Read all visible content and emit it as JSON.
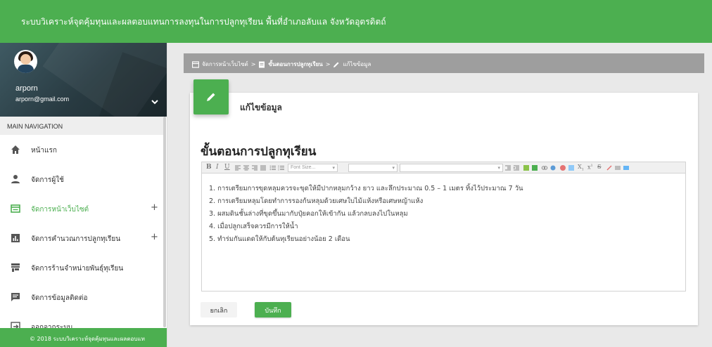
{
  "header": {
    "title": "ระบบวิเคราะห์จุดคุ้มทุนและผลตอบแทนการลงทุนในการปลูกทุเรียน พื้นที่อำเภอลับแล จังหวัดอุตรดิตถ์",
    "bg_color": "#4caf50"
  },
  "user": {
    "name": "arporn",
    "email": "arporn@gmail.com"
  },
  "nav": {
    "header": "MAIN NAVIGATION",
    "items": [
      {
        "label": "หน้าแรก",
        "icon": "home-icon",
        "expandable": false,
        "active": false
      },
      {
        "label": "จัดการผู้ใช้",
        "icon": "person-icon",
        "expandable": false,
        "active": false
      },
      {
        "label": "จัดการหน้าเว็บไซต์",
        "icon": "web-icon",
        "expandable": true,
        "active": true
      },
      {
        "label": "จัดการคำนวณการปลูกทุเรียน",
        "icon": "chart-icon",
        "expandable": true,
        "active": false
      },
      {
        "label": "จัดการร้านจำหน่ายพันธุ์ทุเรียน",
        "icon": "store-icon",
        "expandable": false,
        "active": false
      },
      {
        "label": "จัดการข้อมูลติดต่อ",
        "icon": "chat-icon",
        "expandable": false,
        "active": false
      },
      {
        "label": "ออกจากระบบ",
        "icon": "logout-icon",
        "expandable": false,
        "active": false
      }
    ],
    "expand_symbol": "+"
  },
  "footer": {
    "text": "© 2018 ระบบวิเคราะห์จุดคุ้มทุนและผลตอบแท"
  },
  "breadcrumb": {
    "items": [
      "จัดการหน้าเว็บไซต์",
      "ขั้นตอนการปลูกทุเรียน",
      "แก้ไขข้อมูล"
    ],
    "separator": ">"
  },
  "card": {
    "title": "แก้ไขข้อมูล"
  },
  "document": {
    "title": "ขั้นตอนการปลูกทุเรียน"
  },
  "editor": {
    "toolbar": {
      "bold": "B",
      "italic": "I",
      "underline": "U",
      "font_size_placeholder": "Font Size..."
    },
    "lines": [
      "1. การเตรียมการขุดหลุมควรจะขุดให้มีปากหลุมกว้าง ยาว และลึกประมาณ 0.5 – 1 เมตร ทิ้งไว้ประมาณ 7 วัน",
      "2. การเตรียมหลุมโดยทำการรองก้นหลุมด้วยเศษใบไม้แห้งหรือเศษหญ้าแห้ง",
      "3. ผสมดินชั้นล่างที่ขุดขึ้นมากับปุ๋ยคอกให้เข้ากัน แล้วกลบลงไปในหลุม",
      "4. เมื่อปลูกเสร็จควรมีการให้น้ำ",
      "5. ทำร่มกันแดดให้กับต้นทุเรียนอย่างน้อย 2 เดือน"
    ]
  },
  "buttons": {
    "cancel": "ยกเลิก",
    "save": "บันทึก"
  }
}
